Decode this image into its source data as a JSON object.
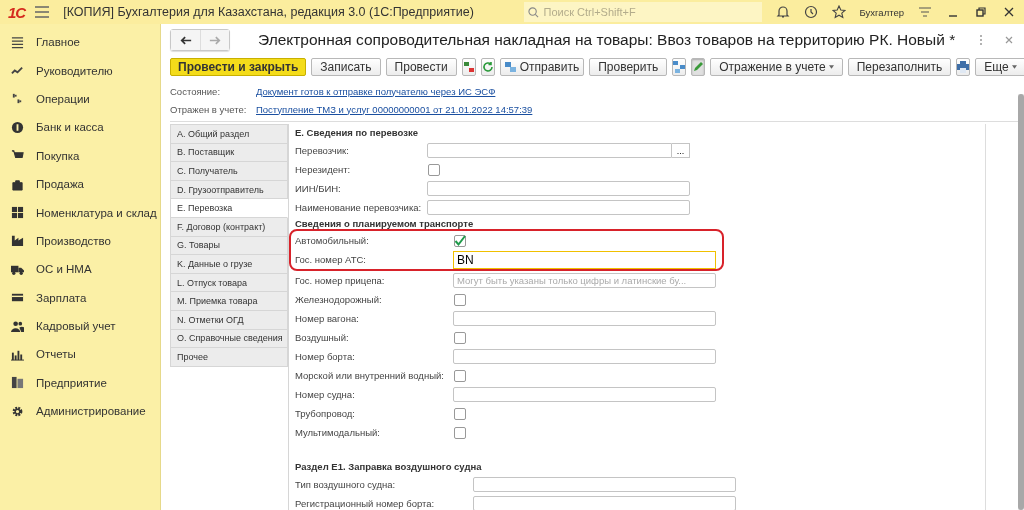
{
  "titlebar": {
    "logo": "1С",
    "title": "[КОПИЯ] Бухгалтерия для Казахстана, редакция 3.0  (1С:Предприятие)",
    "search": {
      "placeholder": "Поиск Ctrl+Shift+F"
    },
    "user": "Бухгалтер"
  },
  "sidebar": {
    "items": [
      {
        "label": "Главное"
      },
      {
        "label": "Руководителю"
      },
      {
        "label": "Операции"
      },
      {
        "label": "Банк и касса"
      },
      {
        "label": "Покупка"
      },
      {
        "label": "Продажа"
      },
      {
        "label": "Номенклатура и склад"
      },
      {
        "label": "Производство"
      },
      {
        "label": "ОС и НМА"
      },
      {
        "label": "Зарплата"
      },
      {
        "label": "Кадровый учет"
      },
      {
        "label": "Отчеты"
      },
      {
        "label": "Предприятие"
      },
      {
        "label": "Администрирование"
      }
    ]
  },
  "document": {
    "title": "Электронная сопроводительная накладная на товары: Ввоз товаров на территорию РК. Новый *",
    "toolbar": [
      {
        "kind": "primary",
        "label": "Провести и закрыть"
      },
      {
        "kind": "button",
        "label": "Записать"
      },
      {
        "kind": "button",
        "label": "Провести"
      },
      {
        "kind": "icon",
        "pressed": false
      },
      {
        "kind": "icon",
        "pressed": false
      },
      {
        "kind": "send",
        "label": "Отправить"
      },
      {
        "kind": "button",
        "label": "Проверить"
      },
      {
        "kind": "icon",
        "pressed": false
      },
      {
        "kind": "icon",
        "pressed": true
      },
      {
        "kind": "dropdown",
        "label": "Отражение в учете"
      },
      {
        "kind": "button",
        "label": "Перезаполнить"
      },
      {
        "kind": "icon",
        "pressed": false
      },
      {
        "kind": "dropdown",
        "label": "Еще"
      }
    ],
    "status": [
      {
        "label": "Состояние:",
        "link": "Документ готов к отправке получателю через ИС ЭСФ"
      },
      {
        "label": "Отражен в учете:",
        "link": "Поступление ТМЗ и услуг 00000000001 от 21.01.2022 14:57:39"
      }
    ],
    "tabs": [
      {
        "label": "A. Общий раздел",
        "selected": false
      },
      {
        "label": "B. Поставщик",
        "selected": false
      },
      {
        "label": "C. Получатель",
        "selected": false
      },
      {
        "label": "D. Грузоотправитель",
        "selected": false
      },
      {
        "label": "E. Перевозка",
        "selected": true
      },
      {
        "label": "F. Договор (контракт)",
        "selected": false
      },
      {
        "label": "G. Товары",
        "selected": false
      },
      {
        "label": "K. Данные о грузе",
        "selected": false
      },
      {
        "label": "L. Отпуск товара",
        "selected": false
      },
      {
        "label": "M. Приемка товара",
        "selected": false
      },
      {
        "label": "N. Отметки ОГД",
        "selected": false
      },
      {
        "label": "O. Справочные сведения",
        "selected": false
      },
      {
        "label": "Прочее",
        "selected": false
      }
    ],
    "groups": [
      {
        "heading": "E. Сведения по перевозке",
        "rows": [
          {
            "kind": "picker",
            "label": "Перевозчик:",
            "button": "..."
          },
          {
            "kind": "checkbox",
            "label": "Нерезидент:",
            "checked": false
          },
          {
            "kind": "field",
            "label": "ИИН/БИН:"
          },
          {
            "kind": "field",
            "label": "Наименование перевозчика:"
          }
        ]
      },
      {
        "heading": "Сведения о планируемом транспорте",
        "highlighted_rows": [
          {
            "kind": "checkbox",
            "label": "Автомобильный:",
            "checked": true
          },
          {
            "kind": "field",
            "label": "Гос. номер АТС:",
            "value": "BN",
            "focused": true
          }
        ],
        "rows": [
          {
            "kind": "field",
            "label": "Гос. номер прицепа:",
            "placeholder": "Могут быть указаны только цифры и латинские бу..."
          },
          {
            "kind": "checkbox",
            "label": "Железнодорожный:",
            "checked": false
          },
          {
            "kind": "field",
            "label": "Номер вагона:"
          },
          {
            "kind": "checkbox",
            "label": "Воздушный:",
            "checked": false
          },
          {
            "kind": "field",
            "label": "Номер борта:"
          },
          {
            "kind": "checkbox",
            "label": "Морской или внутренний водный:",
            "checked": false
          },
          {
            "kind": "field",
            "label": "Номер судна:"
          },
          {
            "kind": "checkbox",
            "label": "Трубопровод:",
            "checked": false
          },
          {
            "kind": "checkbox",
            "label": "Мультимодальный:",
            "checked": false
          }
        ]
      },
      {
        "heading": "Раздел E1. Заправка воздушного судна",
        "rows": [
          {
            "kind": "field",
            "label": "Тип воздушного судна:"
          },
          {
            "kind": "field",
            "label": "Регистрационный номер борта:"
          }
        ]
      }
    ]
  }
}
